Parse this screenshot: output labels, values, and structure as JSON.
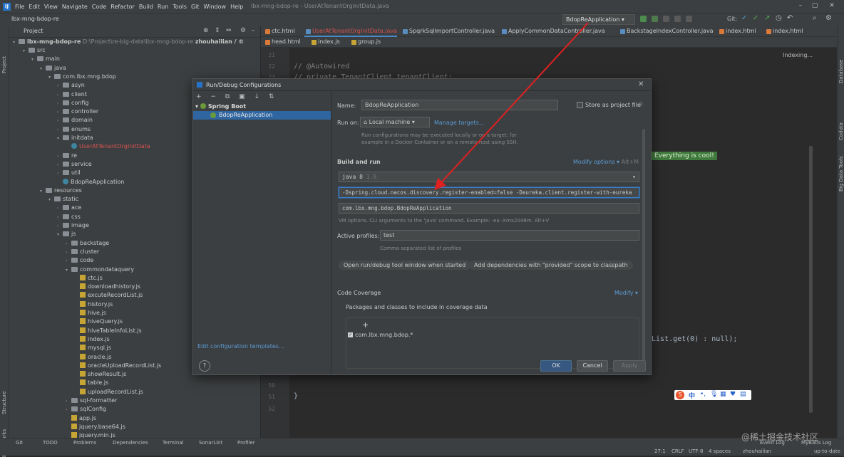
{
  "menu": {
    "items": [
      "File",
      "Edit",
      "View",
      "Navigate",
      "Code",
      "Refactor",
      "Build",
      "Run",
      "Tools",
      "Git",
      "Window",
      "Help"
    ],
    "window_title": "lbx-mng-bdop-re - UserAtTenantOrgInitData.java"
  },
  "navbar": {
    "project": "lbx-mng-bdop-re",
    "run_config": "BdopReApplication",
    "git_label": "Git:"
  },
  "project_panel": {
    "title": "Project",
    "root_name": "lbx-mng-bdop-re",
    "root_path": "D:\\Project\\re-big-data\\lbx-mng-bdop-re",
    "root_user": "zhouhailian / ©"
  },
  "tree": [
    {
      "label": "src",
      "indent": 2,
      "arrow": "▾",
      "icon": "folder"
    },
    {
      "label": "main",
      "indent": 3,
      "arrow": "▾",
      "icon": "folder"
    },
    {
      "label": "java",
      "indent": 4,
      "arrow": "▾",
      "icon": "folder"
    },
    {
      "label": "com.lbx.mng.bdop",
      "indent": 5,
      "arrow": "▾",
      "icon": "folder"
    },
    {
      "label": "asyn",
      "indent": 6,
      "arrow": "›",
      "icon": "folder"
    },
    {
      "label": "client",
      "indent": 6,
      "arrow": "›",
      "icon": "folder"
    },
    {
      "label": "config",
      "indent": 6,
      "arrow": "›",
      "icon": "folder"
    },
    {
      "label": "controller",
      "indent": 6,
      "arrow": "›",
      "icon": "folder"
    },
    {
      "label": "domain",
      "indent": 6,
      "arrow": "›",
      "icon": "folder"
    },
    {
      "label": "enums",
      "indent": 6,
      "arrow": "›",
      "icon": "folder"
    },
    {
      "label": "initdata",
      "indent": 6,
      "arrow": "▾",
      "icon": "folder"
    },
    {
      "label": "UserAtTenantOrgInitData",
      "indent": 7,
      "arrow": "",
      "icon": "class",
      "style": "red"
    },
    {
      "label": "re",
      "indent": 6,
      "arrow": "›",
      "icon": "folder"
    },
    {
      "label": "service",
      "indent": 6,
      "arrow": "›",
      "icon": "folder"
    },
    {
      "label": "util",
      "indent": 6,
      "arrow": "›",
      "icon": "folder"
    },
    {
      "label": "BdopReApplication",
      "indent": 6,
      "arrow": "",
      "icon": "class"
    },
    {
      "label": "resources",
      "indent": 4,
      "arrow": "▾",
      "icon": "folder"
    },
    {
      "label": "static",
      "indent": 5,
      "arrow": "▾",
      "icon": "folder"
    },
    {
      "label": "ace",
      "indent": 6,
      "arrow": "›",
      "icon": "folder"
    },
    {
      "label": "css",
      "indent": 6,
      "arrow": "›",
      "icon": "folder"
    },
    {
      "label": "image",
      "indent": 6,
      "arrow": "›",
      "icon": "folder"
    },
    {
      "label": "js",
      "indent": 6,
      "arrow": "▾",
      "icon": "folder"
    },
    {
      "label": "backstage",
      "indent": 7,
      "arrow": "›",
      "icon": "folder"
    },
    {
      "label": "cluster",
      "indent": 7,
      "arrow": "›",
      "icon": "folder"
    },
    {
      "label": "code",
      "indent": 7,
      "arrow": "›",
      "icon": "folder"
    },
    {
      "label": "commondataquery",
      "indent": 7,
      "arrow": "▾",
      "icon": "folder"
    },
    {
      "label": "ctc.js",
      "indent": 8,
      "arrow": "",
      "icon": "js"
    },
    {
      "label": "downloadhistory.js",
      "indent": 8,
      "arrow": "",
      "icon": "js"
    },
    {
      "label": "excuteRecordList.js",
      "indent": 8,
      "arrow": "",
      "icon": "js"
    },
    {
      "label": "history.js",
      "indent": 8,
      "arrow": "",
      "icon": "js"
    },
    {
      "label": "hive.js",
      "indent": 8,
      "arrow": "",
      "icon": "js"
    },
    {
      "label": "hiveQuery.js",
      "indent": 8,
      "arrow": "",
      "icon": "js"
    },
    {
      "label": "hiveTableInfoList.js",
      "indent": 8,
      "arrow": "",
      "icon": "js"
    },
    {
      "label": "index.js",
      "indent": 8,
      "arrow": "",
      "icon": "js"
    },
    {
      "label": "mysql.js",
      "indent": 8,
      "arrow": "",
      "icon": "js"
    },
    {
      "label": "oracle.js",
      "indent": 8,
      "arrow": "",
      "icon": "js"
    },
    {
      "label": "oracleUploadRecordList.js",
      "indent": 8,
      "arrow": "",
      "icon": "js"
    },
    {
      "label": "showResult.js",
      "indent": 8,
      "arrow": "",
      "icon": "js"
    },
    {
      "label": "table.js",
      "indent": 8,
      "arrow": "",
      "icon": "js"
    },
    {
      "label": "uploadRecordList.js",
      "indent": 8,
      "arrow": "",
      "icon": "js"
    },
    {
      "label": "sql-formatter",
      "indent": 7,
      "arrow": "›",
      "icon": "folder"
    },
    {
      "label": "sqlConfig",
      "indent": 7,
      "arrow": "›",
      "icon": "folder"
    },
    {
      "label": "app.js",
      "indent": 7,
      "arrow": "",
      "icon": "js"
    },
    {
      "label": "jquery.base64.js",
      "indent": 7,
      "arrow": "",
      "icon": "js"
    },
    {
      "label": "jquery.min.js",
      "indent": 7,
      "arrow": "",
      "icon": "js"
    }
  ],
  "editor_tabs_row1": [
    {
      "label": "ctc.html",
      "kind": "html"
    },
    {
      "label": "UserAtTenantOrgInitData.java",
      "kind": "java",
      "active": true
    },
    {
      "label": "SpqrkSqlImportController.java",
      "kind": "java"
    },
    {
      "label": "ApplyCommonDataController.java",
      "kind": "java"
    },
    {
      "label": "BackstageIndexController.java",
      "kind": "java"
    },
    {
      "label": "index.html",
      "kind": "html"
    },
    {
      "label": "index.html",
      "kind": "html"
    }
  ],
  "editor_tabs_row2": [
    {
      "label": "head.html",
      "kind": "html"
    },
    {
      "label": "index.js",
      "kind": "js"
    },
    {
      "label": "group.js",
      "kind": "js"
    }
  ],
  "editor": {
    "lines": [
      {
        "n": "21",
        "text": ""
      },
      {
        "n": "22",
        "text": "//    @Autowired"
      },
      {
        "n": "23",
        "text": "//    private TenantClient tenantClient;"
      },
      {
        "n": "51",
        "text": "}"
      },
      {
        "n": "52",
        "text": ""
      }
    ],
    "code_fragment": "List.get(0) : null);",
    "gutter_numbers": [
      "49",
      "50"
    ],
    "indexing": "Indexing...",
    "status_badge": "Everything is cool!"
  },
  "right_strip": [
    "Database",
    "Codota",
    "Big Data Tools"
  ],
  "left_strip": [
    "Project",
    "Structure",
    "Bookmarks"
  ],
  "dialog": {
    "title": "Run/Debug Configurations",
    "toolbar": "+ − ⧉ ▣ ↓ ⇅",
    "tree_group": "Spring Boot",
    "tree_item": "BdopReApplication",
    "name_label": "Name:",
    "name_value": "BdopReApplication",
    "store_label": "Store as project file",
    "runon_label": "Run on:",
    "runon_value": "Local machine",
    "manage_targets": "Manage targets...",
    "runon_hint_1": "Run configurations may be executed locally or on a target: for",
    "runon_hint_2": "example in a Docker Container or on a remote host using SSH.",
    "build_run_title": "Build and run",
    "modify_options": "Modify options",
    "modify_shortcut": "Alt+M",
    "jdk_value": "java 8",
    "jdk_version": "1.8",
    "vm_options": "-Dspring.cloud.nacos.discovery.register-enabled=false  -Deureka.client.register-with-eureka",
    "main_class": "com.lbx.mng.bdop.BdopReApplication",
    "vm_hint": "VM options. CLI arguments to the 'Java' command. Example: -ea -Xmx2048m. Alt+V",
    "profiles_label": "Active profiles:",
    "profiles_value": "test",
    "profiles_hint": "Comma separated list of profiles",
    "chip1": "Open run/debug tool window when started",
    "chip2": "Add dependencies with \"provided\" scope to classpath",
    "coverage_title": "Code Coverage",
    "coverage_modify": "Modify",
    "coverage_caption": "Packages and classes to include in coverage data",
    "coverage_add": "+",
    "coverage_pkg": "com.lbx.mng.bdop.*",
    "edit_templates": "Edit configuration templates...",
    "help": "?",
    "ok": "OK",
    "cancel": "Cancel",
    "apply": "Apply"
  },
  "toolwindows": [
    "Git",
    "TODO",
    "Problems",
    "Dependencies",
    "Terminal",
    "SonarLint",
    "Profiler",
    "Event Log",
    "MyBatis Log"
  ],
  "status": {
    "position": "27:1",
    "line_sep": "CRLF",
    "encoding": "UTF-8",
    "indent": "4 spaces",
    "user": "zhouhailian",
    "vcs": "up-to-date"
  },
  "ime_label": "中",
  "watermark": "@稀土掘金技术社区",
  "colors": {
    "accent": "#3d7ec8",
    "arrow": "#e02020",
    "selection": "#2f65a0"
  }
}
